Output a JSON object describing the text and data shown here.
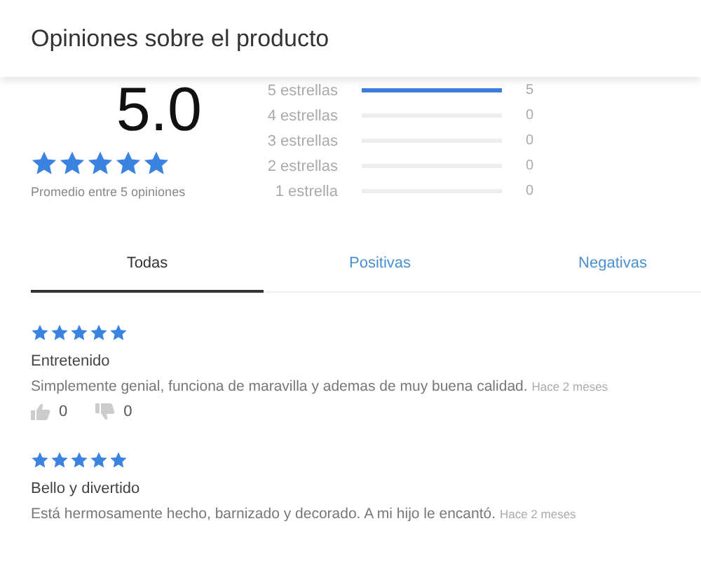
{
  "header": {
    "title": "Opiniones sobre el producto"
  },
  "summary": {
    "score": "5.0",
    "stars": 5,
    "caption": "Promedio entre 5 opiniones"
  },
  "histogram": [
    {
      "label": "5 estrellas",
      "level": 1,
      "count": "5"
    },
    {
      "label": "4 estrellas",
      "count": "0"
    },
    {
      "label": "3 estrellas",
      "count": "0"
    },
    {
      "label": "2 estrellas",
      "count": "0"
    },
    {
      "label": "1 estrella",
      "count": "0"
    }
  ],
  "tabs": [
    {
      "label": "Todas",
      "selected": true
    },
    {
      "label": "Positivas",
      "selected": false
    },
    {
      "label": "Negativas",
      "selected": false
    }
  ],
  "reviews": [
    {
      "stars": 5,
      "title": "Entretenido",
      "text": "Simplemente genial, funciona de maravilla y ademas de muy buena calidad.",
      "time": "Hace 2 meses",
      "likes": "0",
      "dislikes": "0"
    },
    {
      "stars": 5,
      "title": "Bello y divertido",
      "text": "Está hermosamente hecho, barnizado y decorado. A mi hijo le encantó.",
      "time": "Hace 2 meses"
    }
  ]
}
